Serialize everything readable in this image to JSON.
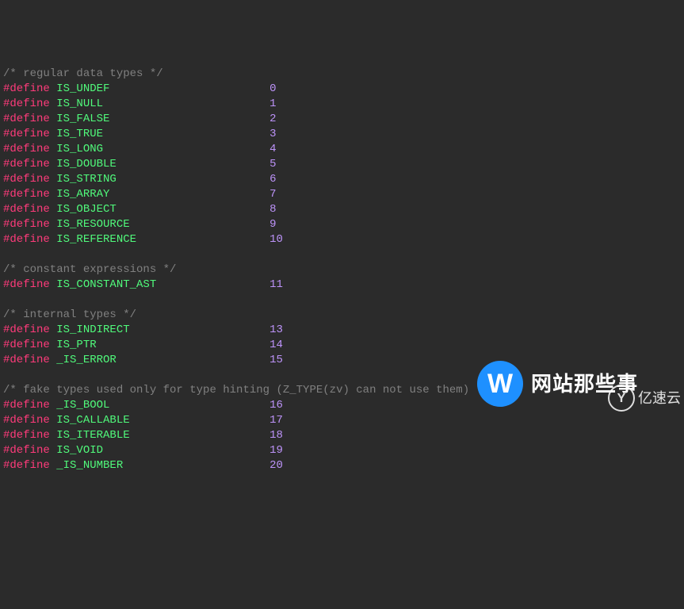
{
  "code": {
    "sections": [
      {
        "comment": "/* regular data types */",
        "lines": [
          {
            "kw": "#define",
            "name": "IS_UNDEF",
            "value": "0"
          },
          {
            "kw": "#define",
            "name": "IS_NULL",
            "value": "1"
          },
          {
            "kw": "#define",
            "name": "IS_FALSE",
            "value": "2"
          },
          {
            "kw": "#define",
            "name": "IS_TRUE",
            "value": "3"
          },
          {
            "kw": "#define",
            "name": "IS_LONG",
            "value": "4"
          },
          {
            "kw": "#define",
            "name": "IS_DOUBLE",
            "value": "5"
          },
          {
            "kw": "#define",
            "name": "IS_STRING",
            "value": "6"
          },
          {
            "kw": "#define",
            "name": "IS_ARRAY",
            "value": "7"
          },
          {
            "kw": "#define",
            "name": "IS_OBJECT",
            "value": "8"
          },
          {
            "kw": "#define",
            "name": "IS_RESOURCE",
            "value": "9"
          },
          {
            "kw": "#define",
            "name": "IS_REFERENCE",
            "value": "10"
          }
        ]
      },
      {
        "comment": "/* constant expressions */",
        "lines": [
          {
            "kw": "#define",
            "name": "IS_CONSTANT_AST",
            "value": "11"
          }
        ]
      },
      {
        "comment": "/* internal types */",
        "lines": [
          {
            "kw": "#define",
            "name": "IS_INDIRECT",
            "value": "13"
          },
          {
            "kw": "#define",
            "name": "IS_PTR",
            "value": "14"
          },
          {
            "kw": "#define",
            "name": "_IS_ERROR",
            "value": "15"
          }
        ]
      },
      {
        "comment": "/* fake types used only for type hinting (Z_TYPE(zv) can not use them) */",
        "lines": [
          {
            "kw": "#define",
            "name": "_IS_BOOL",
            "value": "16"
          },
          {
            "kw": "#define",
            "name": "IS_CALLABLE",
            "value": "17"
          },
          {
            "kw": "#define",
            "name": "IS_ITERABLE",
            "value": "18"
          },
          {
            "kw": "#define",
            "name": "IS_VOID",
            "value": "19"
          },
          {
            "kw": "#define",
            "name": "_IS_NUMBER",
            "value": "20"
          }
        ]
      }
    ]
  },
  "watermarks": {
    "primary": {
      "letter": "W",
      "text": "网站那些事"
    },
    "secondary": {
      "letter": "Y",
      "text": "亿速云"
    }
  }
}
